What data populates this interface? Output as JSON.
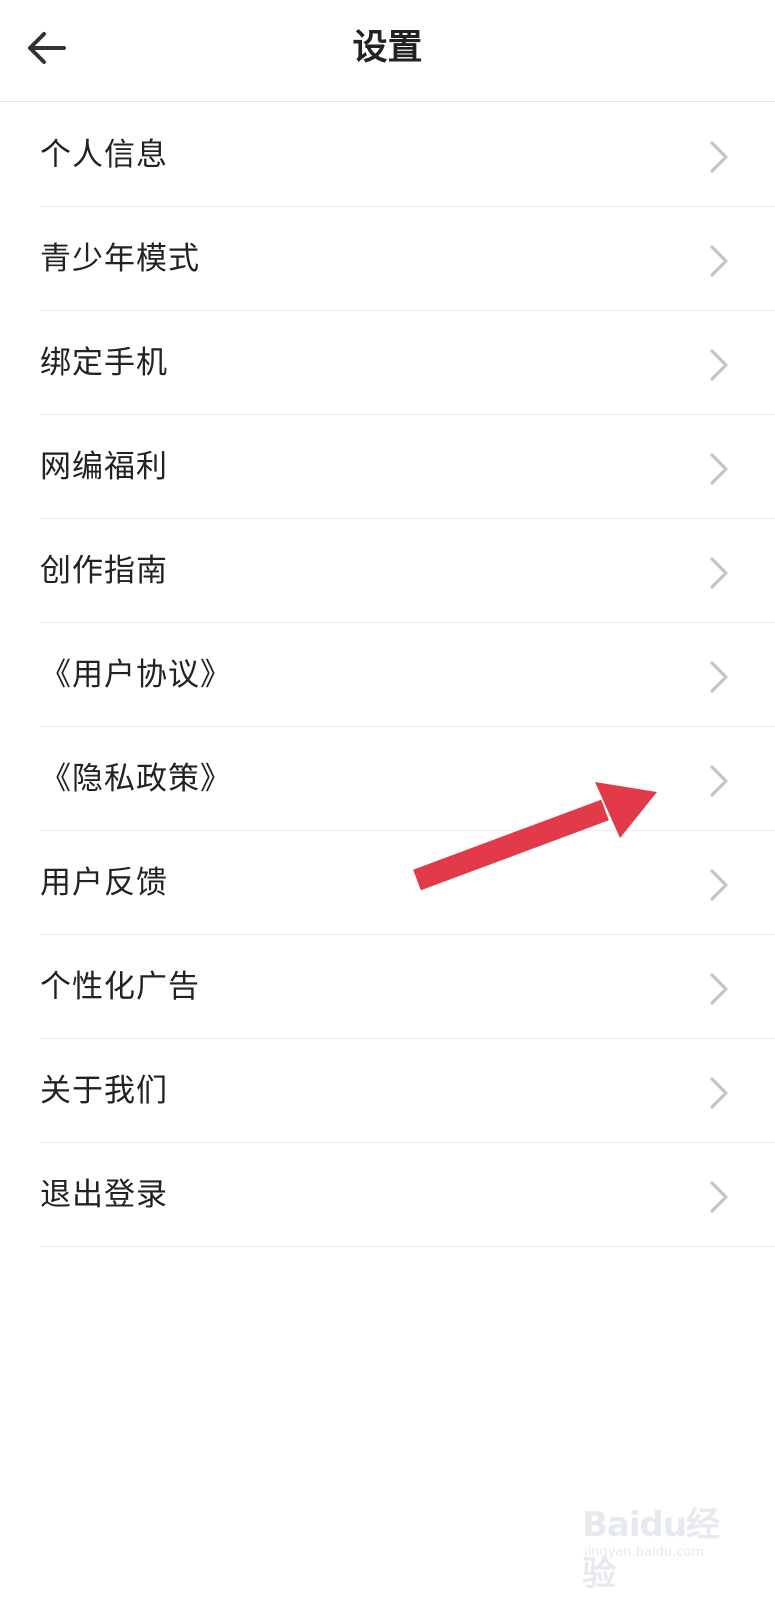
{
  "header": {
    "title": "设置",
    "back_icon": "arrow-left-icon"
  },
  "settings": [
    {
      "label": "个人信息"
    },
    {
      "label": "青少年模式"
    },
    {
      "label": "绑定手机"
    },
    {
      "label": "网编福利"
    },
    {
      "label": "创作指南"
    },
    {
      "label": "《用户协议》"
    },
    {
      "label": "《隐私政策》"
    },
    {
      "label": "用户反馈"
    },
    {
      "label": "个性化广告"
    },
    {
      "label": "关于我们"
    },
    {
      "label": "退出登录"
    }
  ],
  "chevron_icon": "chevron-right-icon",
  "annotation": {
    "icon": "red-arrow-icon",
    "color": "#e23a48"
  },
  "watermark": {
    "logo": "Baidu经验",
    "sub": "jingyan.baidu.com"
  },
  "colors": {
    "text": "#222222",
    "chevron": "#c4c4c4",
    "divider": "#ececec",
    "background": "#ffffff"
  }
}
